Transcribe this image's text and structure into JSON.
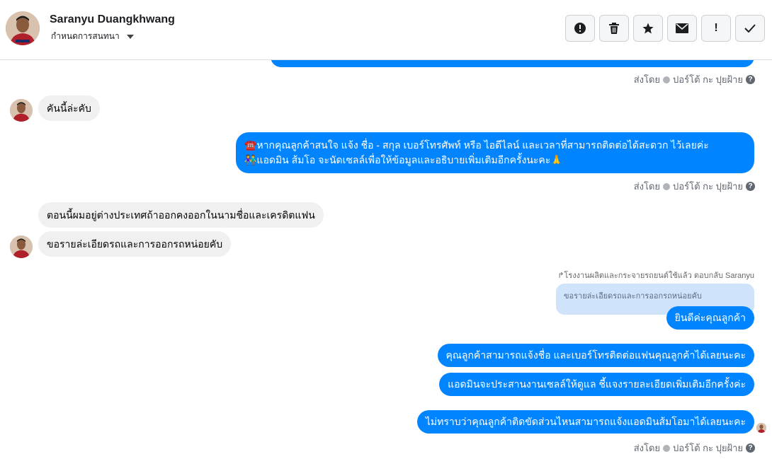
{
  "header": {
    "contact_name": "Saranyu Duangkhwang",
    "assign_label": "กำหนดการสนทนา",
    "toolbar": [
      {
        "name": "alert-icon",
        "glyph": "!"
      },
      {
        "name": "trash-icon",
        "glyph": "🗑"
      },
      {
        "name": "star-icon",
        "glyph": "★"
      },
      {
        "name": "mail-icon",
        "glyph": "✉"
      },
      {
        "name": "exclamation-icon",
        "glyph": "!"
      },
      {
        "name": "check-icon",
        "glyph": "✓"
      }
    ]
  },
  "sent_by": {
    "prefix": "ส่งโดย",
    "sender": "ปอร์โต้ กะ ปุยฝ้าย",
    "help": "?"
  },
  "messages": {
    "in_1": "คันนี้ล่ะคับ",
    "out_1_line1": "☎️หากคุณลูกค้าสนใจ แจ้ง ชื่อ - สกุล เบอร์โทรศัพท์ หรือ ไอดีไลน์ และเวลาที่สามารถติดต่อได้สะดวก ไว้เลยค่ะ",
    "out_1_line2": "👫แอดมิน ส้มโอ จะนัดเซลล์เพื่อให้ข้อมูลและอธิบายเพิ่มเติมอีกครั้งนะคะ🙏",
    "in_2": "ตอนนี้ผมอยู่ต่างประเทศถ้าออกคงออกในนามชื่อและเครดิตแฟน",
    "in_3": "ขอรายล่ะเอียดรถและการออกรถหน่อยคับ",
    "reply_meta": "↱โรงงานผลิตและกระจายรถยนต์ใช้แล้ว ตอบกลับ Saranyu",
    "quoted": "ขอรายล่ะเอียดรถและการออกรถหน่อยคับ",
    "out_2": "ยินดีค่ะคุณลูกค้า",
    "out_3": "คุณลูกค้าสามารถแจ้งชื่อ และเบอร์โทรติดต่อแฟนคุณลูกค้าได้เลยนะคะ",
    "out_4": "แอดมินจะประสานงานเซลล์ให้ดูแล ชี้แจงรายละเอียดเพิ่มเติมอีกครั้งค่ะ",
    "out_5": "ไม่ทราบว่าคุณลูกค้าติดขัดส่วนไหนสามารถแจ้งแอดมินส้มโอมาได้เลยนะคะ"
  }
}
